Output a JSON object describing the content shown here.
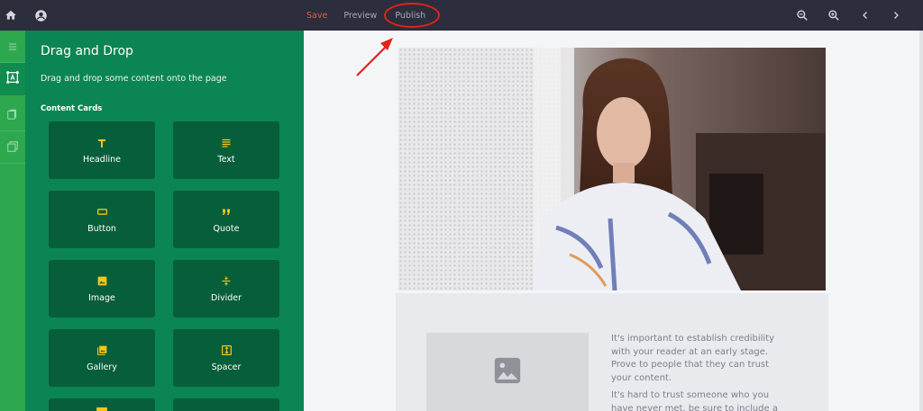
{
  "topbar": {
    "icons": [
      "home-icon",
      "account-circle-icon",
      "zoom-out-icon",
      "zoom-in-icon",
      "chevron-left-icon",
      "chevron-right-icon"
    ],
    "links": {
      "save": "Save",
      "preview": "Preview",
      "publish": "Publish"
    },
    "colors": {
      "background": "#2c2d3d",
      "save": "#e2603e",
      "link": "#a7a9b8",
      "annotation": "#e2231a"
    }
  },
  "rail": {
    "items": [
      "list-icon",
      "drag-drop-icon",
      "pages-icon",
      "layers-icon"
    ],
    "active_index": 1
  },
  "panel": {
    "title": "Drag and Drop",
    "subtitle": "Drag and drop some content onto the page",
    "section": "Content Cards",
    "cards": [
      {
        "label": "Headline",
        "icon": "headline-icon"
      },
      {
        "label": "Text",
        "icon": "text-icon"
      },
      {
        "label": "Button",
        "icon": "button-icon"
      },
      {
        "label": "Quote",
        "icon": "quote-icon"
      },
      {
        "label": "Image",
        "icon": "image-icon"
      },
      {
        "label": "Divider",
        "icon": "divider-icon"
      },
      {
        "label": "Gallery",
        "icon": "gallery-icon"
      },
      {
        "label": "Spacer",
        "icon": "spacer-icon"
      }
    ],
    "colors": {
      "background": "#0b8553",
      "card": "#075e3a",
      "icon": "#f5c518"
    }
  },
  "canvas": {
    "body_paragraphs": [
      "It's important to establish credibility with your reader at an early stage. Prove to people that they can trust your content.",
      "It's hard to trust someone who you have never met, be sure to include a"
    ]
  }
}
